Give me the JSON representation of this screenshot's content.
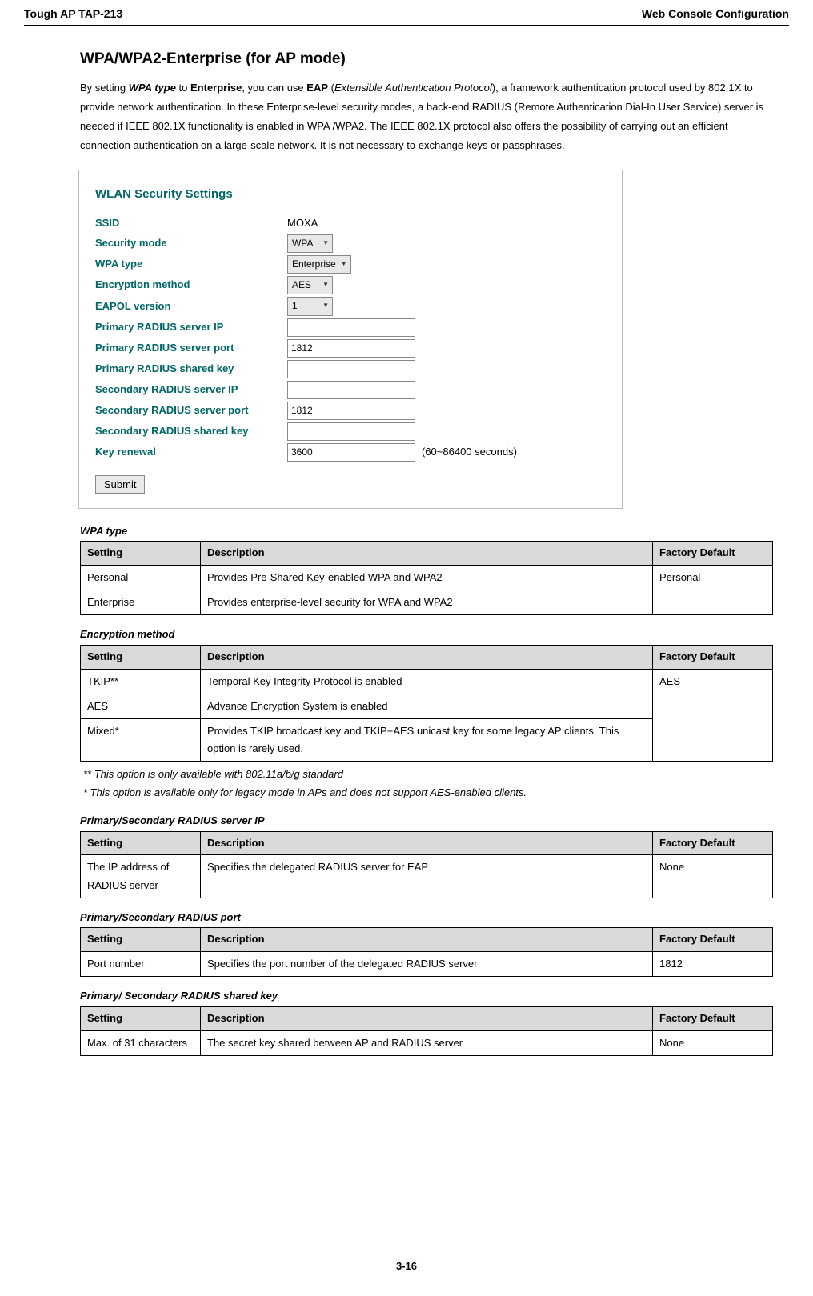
{
  "header": {
    "left": "Tough AP TAP-213",
    "right": "Web Console Configuration"
  },
  "section_title": "WPA/WPA2-Enterprise (for AP mode)",
  "intro_html": "By setting <b><i>WPA type</i></b> to <b>Enterprise</b>, you can use <b>EAP</b> (<i>Extensible Authentication Protocol</i>), a framework authentication protocol used by 802.1X to provide network authentication. In these Enterprise-level security modes, a back-end RADIUS (Remote Authentication Dial-In User Service) server is needed if IEEE 802.1X functionality is enabled in WPA /WPA2. The IEEE 802.1X protocol also offers the possibility of carrying out an efficient connection authentication on a large-scale network. It is not necessary to exchange keys or passphrases.",
  "form": {
    "title": "WLAN Security Settings",
    "rows": [
      {
        "label": "SSID",
        "type": "static",
        "value": "MOXA"
      },
      {
        "label": "Security mode",
        "type": "dropdown",
        "value": "WPA"
      },
      {
        "label": "WPA type",
        "type": "dropdown",
        "value": "Enterprise"
      },
      {
        "label": "Encryption method",
        "type": "dropdown",
        "value": "AES"
      },
      {
        "label": "EAPOL version",
        "type": "dropdown",
        "value": "1"
      },
      {
        "label": "Primary RADIUS server IP",
        "type": "text",
        "value": ""
      },
      {
        "label": "Primary RADIUS server port",
        "type": "text",
        "value": "1812"
      },
      {
        "label": "Primary RADIUS shared key",
        "type": "text",
        "value": ""
      },
      {
        "label": "Secondary RADIUS server IP",
        "type": "text",
        "value": ""
      },
      {
        "label": "Secondary RADIUS server port",
        "type": "text",
        "value": "1812"
      },
      {
        "label": "Secondary RADIUS shared key",
        "type": "text",
        "value": ""
      },
      {
        "label": "Key renewal",
        "type": "text",
        "value": "3600",
        "suffix": "(60~86400 seconds)"
      }
    ],
    "submit": "Submit"
  },
  "tables": [
    {
      "caption": "WPA type",
      "headers": [
        "Setting",
        "Description",
        "Factory Default"
      ],
      "rows": [
        {
          "cells": [
            "Personal",
            "Provides Pre-Shared Key-enabled WPA and WPA2"
          ],
          "default": "Personal",
          "default_rowspan": 2
        },
        {
          "cells": [
            "Enterprise",
            "Provides enterprise-level security for WPA and WPA2"
          ]
        }
      ]
    },
    {
      "caption": "Encryption method",
      "headers": [
        "Setting",
        "Description",
        "Factory Default"
      ],
      "rows": [
        {
          "cells": [
            "TKIP**",
            "Temporal Key Integrity Protocol is enabled"
          ],
          "default": "AES",
          "default_rowspan": 3
        },
        {
          "cells": [
            "AES",
            "Advance Encryption System is enabled"
          ]
        },
        {
          "cells": [
            "Mixed*",
            "Provides TKIP broadcast key and TKIP+AES unicast key for some legacy AP clients. This option is rarely used."
          ]
        }
      ],
      "footnotes": [
        "** This option is only available with 802.11a/b/g standard",
        "* This option is available only for legacy mode in APs and does not support AES-enabled clients."
      ]
    },
    {
      "caption": "Primary/Secondary RADIUS server IP",
      "headers": [
        "Setting",
        "Description",
        "Factory Default"
      ],
      "rows": [
        {
          "cells": [
            "The IP address of RADIUS server",
            "Specifies the delegated RADIUS server for EAP"
          ],
          "default": "None",
          "default_rowspan": 1
        }
      ]
    },
    {
      "caption": "Primary/Secondary RADIUS port",
      "headers": [
        "Setting",
        "Description",
        "Factory Default"
      ],
      "rows": [
        {
          "cells": [
            "Port number",
            "Specifies the port number of the delegated RADIUS server"
          ],
          "default": "1812",
          "default_rowspan": 1
        }
      ]
    },
    {
      "caption": "Primary/ Secondary RADIUS shared key",
      "headers": [
        "Setting",
        "Description",
        "Factory Default"
      ],
      "rows": [
        {
          "cells": [
            "Max. of 31 characters",
            "The secret key shared between AP and RADIUS server"
          ],
          "default": "None",
          "default_rowspan": 1
        }
      ]
    }
  ],
  "page_number": "3-16"
}
